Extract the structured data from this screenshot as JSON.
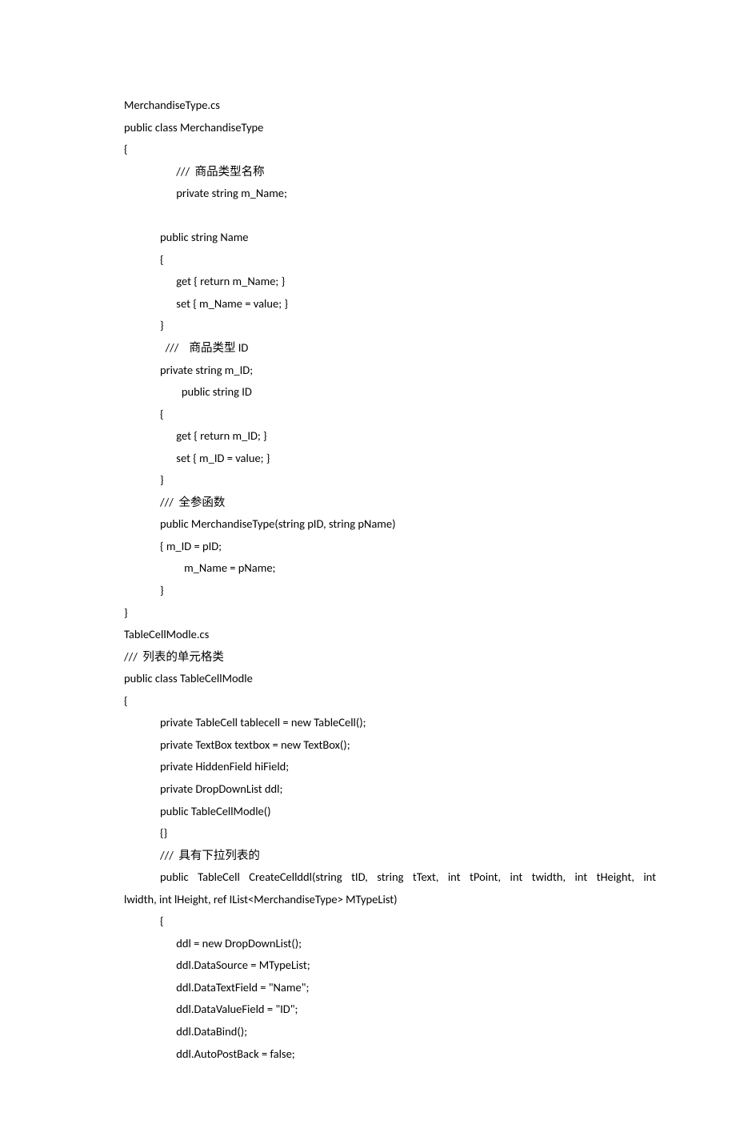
{
  "lines": [
    {
      "text": "MerchandiseType.cs",
      "indent": "indent-1"
    },
    {
      "text": "public class MerchandiseType",
      "indent": "indent-1"
    },
    {
      "text": "{",
      "indent": "indent-1"
    },
    {
      "text": " ///  商品类型名称",
      "indent": "indent-4"
    },
    {
      "text": " private string m_Name;",
      "indent": "indent-4"
    },
    {
      "text": " ",
      "indent": "indent-1"
    },
    {
      "text": "public string Name",
      "indent": "indent-2"
    },
    {
      "text": "{",
      "indent": "indent-2"
    },
    {
      "text": " get { return m_Name; }",
      "indent": "indent-4"
    },
    {
      "text": " set { m_Name = value; }",
      "indent": "indent-4"
    },
    {
      "text": "}",
      "indent": "indent-2"
    },
    {
      "text": "  ///    商品类型 ID",
      "indent": "indent-2"
    },
    {
      "text": "private string m_ID;",
      "indent": "indent-2"
    },
    {
      "text": "   public string ID",
      "indent": "indent-4"
    },
    {
      "text": "{",
      "indent": "indent-2"
    },
    {
      "text": " get { return m_ID; }",
      "indent": "indent-4"
    },
    {
      "text": " set { m_ID = value; }",
      "indent": "indent-4"
    },
    {
      "text": "}",
      "indent": "indent-2"
    },
    {
      "text": "///  全参函数",
      "indent": "indent-2"
    },
    {
      "text": "public MerchandiseType(string pID, string pName)",
      "indent": "indent-2"
    },
    {
      "text": "{ m_ID = pID;",
      "indent": "indent-2"
    },
    {
      "text": "    m_Name = pName;",
      "indent": "indent-4"
    },
    {
      "text": "}",
      "indent": "indent-2"
    },
    {
      "text": "}",
      "indent": "indent-1"
    },
    {
      "text": "TableCellModle.cs",
      "indent": "indent-1"
    },
    {
      "text": "///  列表的单元格类",
      "indent": "indent-1"
    },
    {
      "text": "public class TableCellModle",
      "indent": "indent-1"
    },
    {
      "text": "{",
      "indent": "indent-1"
    },
    {
      "text": "private TableCell tablecell = new TableCell();",
      "indent": "indent-2"
    },
    {
      "text": "private TextBox textbox = new TextBox();",
      "indent": "indent-2"
    },
    {
      "text": "private HiddenField hiField;",
      "indent": "indent-2"
    },
    {
      "text": "private DropDownList ddl;",
      "indent": "indent-2"
    },
    {
      "text": "public TableCellModle()",
      "indent": "indent-2"
    },
    {
      "text": "{}",
      "indent": "indent-2"
    },
    {
      "text": "///  具有下拉列表的",
      "indent": "indent-2"
    },
    {
      "text": "public TableCell CreateCellddl(string tID, string tText, int tPoint, int twidth, int tHeight, int",
      "indent": "indent-2",
      "justified": true
    },
    {
      "text": "lwidth, int lHeight, ref IList<MerchandiseType> MTypeList)",
      "indent": "indent-1"
    },
    {
      "text": "{",
      "indent": "indent-2"
    },
    {
      "text": " ddl = new DropDownList();",
      "indent": "indent-4"
    },
    {
      "text": " ddl.DataSource = MTypeList;",
      "indent": "indent-4"
    },
    {
      "text": " ddl.DataTextField = \"Name\";",
      "indent": "indent-4"
    },
    {
      "text": " ddl.DataValueField = \"ID\";",
      "indent": "indent-4"
    },
    {
      "text": " ddl.DataBind();",
      "indent": "indent-4"
    },
    {
      "text": " ddl.AutoPostBack = false;",
      "indent": "indent-4"
    }
  ]
}
